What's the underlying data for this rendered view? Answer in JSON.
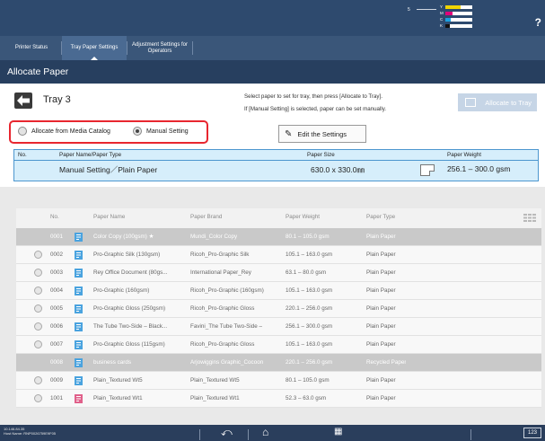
{
  "status_bar": {
    "toner_count": "5",
    "toner_levels": [
      {
        "label": "Y",
        "color": "#f0d400",
        "level": 0.55
      },
      {
        "label": "M",
        "color": "#e0007a",
        "level": 0.25
      },
      {
        "label": "C",
        "color": "#1aa0e0",
        "level": 0.2
      },
      {
        "label": "K",
        "color": "#111111",
        "level": 0.15
      }
    ],
    "help_icon": "question-icon"
  },
  "tabs": [
    {
      "label": "Printer Status",
      "active": false
    },
    {
      "label": "Tray Paper Settings",
      "active": true
    },
    {
      "label": "Adjustment Settings for Operators",
      "active": false
    }
  ],
  "page_title": "Allocate Paper",
  "tray": {
    "label": "Tray 3",
    "instruction_line1": "Select paper to set for tray, then press [Allocate to Tray].",
    "instruction_line2": "If [Manual Setting] is selected, paper can be set manually.",
    "allocate_button": "Allocate to Tray"
  },
  "options": {
    "from_catalog": "Allocate from Media Catalog",
    "manual": "Manual Setting",
    "selected": "manual",
    "edit_button": "Edit the Settings"
  },
  "selected_paper": {
    "headers": {
      "no": "No.",
      "name": "Paper Name/Paper Type",
      "size": "Paper Size",
      "weight": "Paper Weight"
    },
    "name_value": "Manual Setting／Plain Paper",
    "size_value": "630.0 x 330.0㎜",
    "weight_value": "256.1 – 300.0 gsm"
  },
  "list": {
    "headers": [
      "No.",
      "Paper Name",
      "Paper Brand",
      "Paper Weight",
      "Paper Type"
    ],
    "rows": [
      {
        "no": "0001",
        "name": "Color Copy (100gsm) ★",
        "brand": "Mundi_Color Copy",
        "weight": "80.1 – 105.0 gsm",
        "type": "Plain Paper",
        "disabled": true,
        "icon_color": "#4aa3df"
      },
      {
        "no": "0002",
        "name": "Pro-Graphic Silk (130gsm)",
        "brand": "Ricoh_Pro-Graphic Silk",
        "weight": "105.1 – 163.0 gsm",
        "type": "Plain Paper",
        "disabled": false,
        "icon_color": "#4aa3df"
      },
      {
        "no": "0003",
        "name": "Rey Office Document (80gs...",
        "brand": "International Paper_Rey",
        "weight": "63.1 – 80.0 gsm",
        "type": "Plain Paper",
        "disabled": false,
        "icon_color": "#4aa3df"
      },
      {
        "no": "0004",
        "name": "Pro-Graphic (160gsm)",
        "brand": "Ricoh_Pro-Graphic (160gsm)",
        "weight": "105.1 – 163.0 gsm",
        "type": "Plain Paper",
        "disabled": false,
        "icon_color": "#4aa3df"
      },
      {
        "no": "0005",
        "name": "Pro-Graphic Gloss (250gsm)",
        "brand": "Ricoh_Pro-Graphic Gloss",
        "weight": "220.1 – 256.0 gsm",
        "type": "Plain Paper",
        "disabled": false,
        "icon_color": "#4aa3df"
      },
      {
        "no": "0006",
        "name": "The Tube Two-Side – Black...",
        "brand": "Favini_The Tube Two-Side –",
        "weight": "256.1 – 300.0 gsm",
        "type": "Plain Paper",
        "disabled": false,
        "icon_color": "#4aa3df"
      },
      {
        "no": "0007",
        "name": "Pro-Graphic Gloss (115gsm)",
        "brand": "Ricoh_Pro-Graphic Gloss",
        "weight": "105.1 – 163.0 gsm",
        "type": "Plain Paper",
        "disabled": false,
        "icon_color": "#4aa3df"
      },
      {
        "no": "0008",
        "name": "business cards",
        "brand": "Arjowiggins Graphic_Cocoon",
        "weight": "220.1 – 256.0 gsm",
        "type": "Recycled Paper",
        "disabled": true,
        "icon_color": "#4aa3df"
      },
      {
        "no": "0009",
        "name": "Plain_Textured Wt5",
        "brand": "Plain_Textured Wt5",
        "weight": "80.1 – 105.0 gsm",
        "type": "Plain Paper",
        "disabled": false,
        "icon_color": "#4aa3df"
      },
      {
        "no": "1001",
        "name": "Plain_Textured Wt1",
        "brand": "Plain_Textured Wt1",
        "weight": "52.3 – 63.0 gsm",
        "type": "Plain Paper",
        "disabled": false,
        "icon_color": "#e0608a"
      }
    ]
  },
  "bottom_bar": {
    "ip_line1": "10.146.84.35",
    "ip_line2": "Host Name: RNP0026759E9F05",
    "counter": "123"
  }
}
